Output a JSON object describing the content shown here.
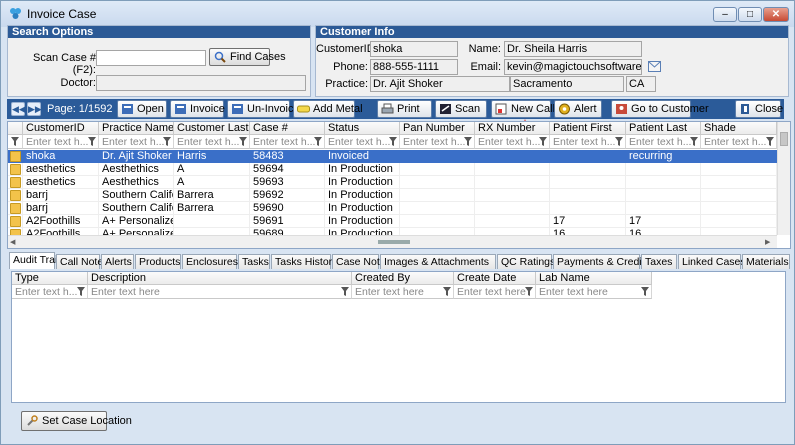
{
  "window": {
    "title": "Invoice Case",
    "min": "–",
    "max": "□",
    "close": "✕"
  },
  "search": {
    "header": "Search Options",
    "scan_label": "Scan Case # (F2):",
    "scan_value": "",
    "find_button": "Find Cases",
    "doctor_label": "Doctor:",
    "doctor_value": ""
  },
  "customer": {
    "header": "Customer Info",
    "id_label": "CustomerID:",
    "id_value": "shoka",
    "name_label": "Name:",
    "name_value": "Dr. Sheila Harris",
    "phone_label": "Phone:",
    "phone_value": "888-555-1111",
    "email_label": "Email:",
    "email_value": "kevin@magictouchsoftware.com",
    "practice_label": "Practice:",
    "practice_value": "Dr. Ajit Shoker",
    "city_value": "Sacramento",
    "state_value": "CA"
  },
  "toolbar": {
    "page": "Page: 1/1592",
    "open": "Open",
    "invoice": "Invoice",
    "uninvoice": "Un-Invoice",
    "addmetal": "Add Metal",
    "print": "Print",
    "scan": "Scan",
    "newcall": "New Call",
    "alert": "Alert",
    "gotocustomer": "Go to Customer",
    "close": "Close"
  },
  "grid": {
    "columns": [
      "CustomerID",
      "Practice Name",
      "Customer Last ...",
      "Case #",
      "Status",
      "Pan Number",
      "RX Number",
      "Patient First",
      "Patient Last",
      "Shade"
    ],
    "filter_placeholder": "Enter text h...",
    "rows": [
      [
        "shoka",
        "Dr. Ajit Shoker",
        "Harris",
        "58483",
        "Invoiced",
        "",
        "",
        "",
        "recurring",
        ""
      ],
      [
        "aesthetics",
        "Aesthethics",
        "A",
        "59694",
        "In Production",
        "",
        "",
        "",
        "",
        ""
      ],
      [
        "aesthetics",
        "Aesthethics",
        "A",
        "59693",
        "In Production",
        "",
        "",
        "",
        "",
        ""
      ],
      [
        "barrj",
        "Southern Califo...",
        "Barrera",
        "59692",
        "In Production",
        "",
        "",
        "",
        "",
        ""
      ],
      [
        "barrj",
        "Southern Califo...",
        "Barrera",
        "59690",
        "In Production",
        "",
        "",
        "",
        "",
        ""
      ],
      [
        "A2Foothills",
        "A+ Personalize...",
        "",
        "59691",
        "In Production",
        "",
        "",
        "17",
        "17",
        ""
      ],
      [
        "A2Foothills",
        "A+ Personalize...",
        "",
        "59689",
        "In Production",
        "",
        "",
        "16",
        "16",
        ""
      ]
    ]
  },
  "tabs": [
    "Audit Trail",
    "Call Notes",
    "Alerts",
    "Products",
    "Enclosures",
    "Tasks",
    "Tasks History",
    "Case Notes",
    "Images & Attachments",
    "QC Ratings",
    "Payments & Credits",
    "Taxes",
    "Linked Cases",
    "Materials"
  ],
  "audit": {
    "columns": [
      "Type",
      "Description",
      "Created By",
      "Create Date",
      "Lab Name"
    ],
    "filter_placeholder": "Enter text here",
    "type_placeholder": "Enter text h..."
  },
  "set_location": "Set Case Location",
  "colors": {
    "header_blue": "#2c5a96",
    "toolbar_blue": "#2b5b99",
    "selection": "#3a6fc8",
    "red_arrow": "#d9302a"
  }
}
